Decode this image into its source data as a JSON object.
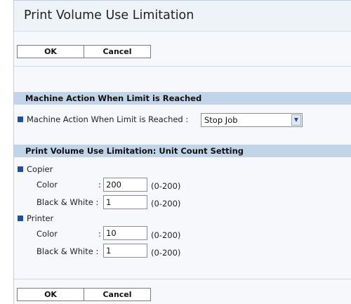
{
  "page": {
    "title": "Print Volume Use Limitation"
  },
  "buttons": {
    "ok_label": "OK",
    "cancel_label": "Cancel"
  },
  "sections": {
    "machine_action": {
      "header": "Machine Action When Limit is Reached",
      "field_label": "Machine Action When Limit is Reached",
      "separator": ":",
      "selected_value": "Stop Job"
    },
    "unit_count": {
      "header": "Print Volume Use Limitation: Unit Count Setting",
      "copier": {
        "label": "Copier",
        "color_label": "Color",
        "color_value": "200",
        "bw_label": "Black & White",
        "bw_value": "1"
      },
      "printer": {
        "label": "Printer",
        "color_label": "Color",
        "color_value": "10",
        "bw_label": "Black & White",
        "bw_value": "1"
      },
      "separator": ":",
      "range": "(0-200)"
    }
  },
  "colors": {
    "panel_background": "#f6f8fb",
    "section_header": "#c2d5e8",
    "bullet": "#1c4fa3"
  }
}
